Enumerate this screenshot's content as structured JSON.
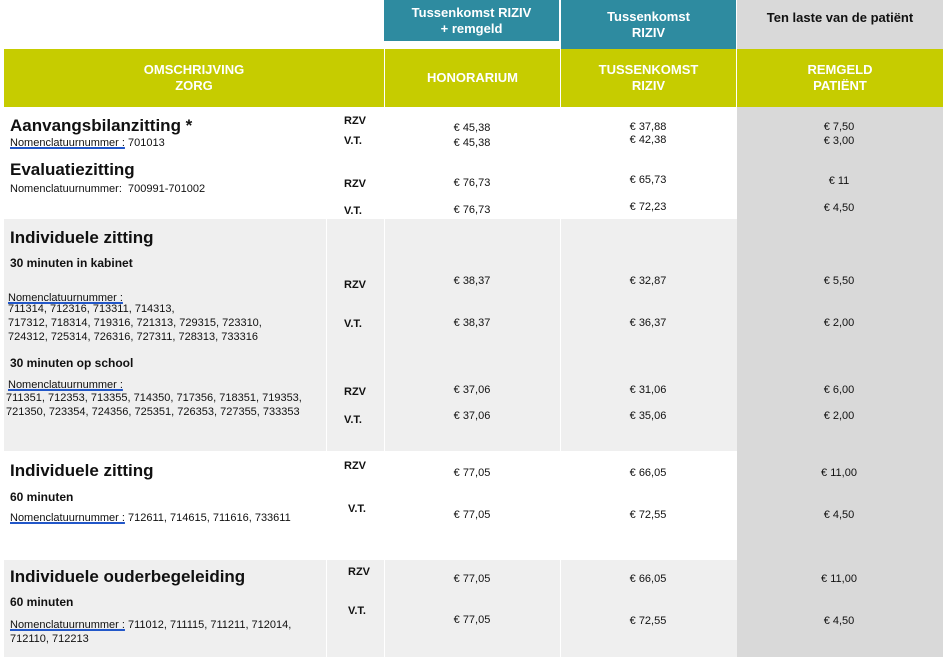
{
  "top_headers": {
    "honorarium_group": "Tussenkomst RIZIV\n+ remgeld",
    "riziv_group": "Tussenkomst\nRIZIV",
    "patient_group": "Ten laste van de patiënt"
  },
  "column_headers": {
    "omschrijving": "OMSCHRIJVING\nZORG",
    "honorarium": "HONORARIUM",
    "tussenkomst": "TUSSENKOMST\nRIZIV",
    "remgeld": "REMGELD\nPATIËNT"
  },
  "labels": {
    "nomen": "Nomenclatuurnummer :",
    "nomen_plain": "Nomenclatuurnummer:"
  },
  "rows": {
    "aanvang": {
      "title": "Aanvangsbilanzitting *",
      "nomen_codes": "701013",
      "codes": [
        "RZV",
        "V.T."
      ],
      "honorarium": [
        "€ 45,38",
        "€ 45,38"
      ],
      "tussenkomst": [
        "€ 37,88",
        "€ 42,38"
      ],
      "remgeld": [
        "€ 7,50",
        "€ 3,00"
      ]
    },
    "evaluatie": {
      "title": "Evaluatiezitting",
      "nomen_codes": "700991-701002",
      "codes": [
        "RZV",
        "V.T."
      ],
      "honorarium": [
        "€ 76,73",
        "€ 76,73"
      ],
      "tussenkomst": [
        "€ 65,73",
        "€ 72,23"
      ],
      "remgeld": [
        "€ 11",
        "€ 4,50"
      ]
    },
    "indiv1": {
      "title": "Individuele zitting",
      "kabinet": {
        "sub": "30 minuten in kabinet",
        "nomen_lines": [
          "711314, 712316, 713311, 714313,",
          "717312, 718314, 719316, 721313, 729315, 723310,",
          "724312, 725314, 726316, 727311, 728313, 733316"
        ],
        "codes": [
          "RZV",
          "V.T."
        ],
        "honorarium": [
          "€ 38,37",
          "€ 38,37"
        ],
        "tussenkomst": [
          "€ 32,87",
          "€ 36,37"
        ],
        "remgeld": [
          "€ 5,50",
          "€ 2,00"
        ]
      },
      "school": {
        "sub": "30 minuten op school",
        "nomen_lines": [
          "711351, 712353, 713355, 714350, 717356, 718351, 719353,",
          "721350, 723354, 724356, 725351, 726353, 727355, 733353"
        ],
        "codes": [
          "RZV",
          "V.T."
        ],
        "honorarium": [
          "€ 37,06",
          "€ 37,06"
        ],
        "tussenkomst": [
          "€ 31,06",
          "€ 35,06"
        ],
        "remgeld": [
          "€ 6,00",
          "€ 2,00"
        ]
      }
    },
    "indiv2": {
      "title": "Individuele zitting",
      "sub": "60 minuten",
      "nomen_codes": "712611, 714615, 711616, 733611",
      "codes": [
        "RZV",
        "V.T."
      ],
      "honorarium": [
        "€ 77,05",
        "€ 77,05"
      ],
      "tussenkomst": [
        "€ 66,05",
        "€ 72,55"
      ],
      "remgeld": [
        "€ 11,00",
        "€ 4,50"
      ]
    },
    "ouder": {
      "title": "Individuele ouderbegeleiding",
      "sub": "60 minuten",
      "nomen_line1": "711012, 711115, 711211, 712014,",
      "nomen_line2": "712110, 712213",
      "codes": [
        "RZV",
        "V.T."
      ],
      "honorarium": [
        "€ 77,05",
        "€ 77,05"
      ],
      "tussenkomst": [
        "€ 66,05",
        "€ 72,55"
      ],
      "remgeld": [
        "€ 11,00",
        "€ 4,50"
      ]
    }
  }
}
